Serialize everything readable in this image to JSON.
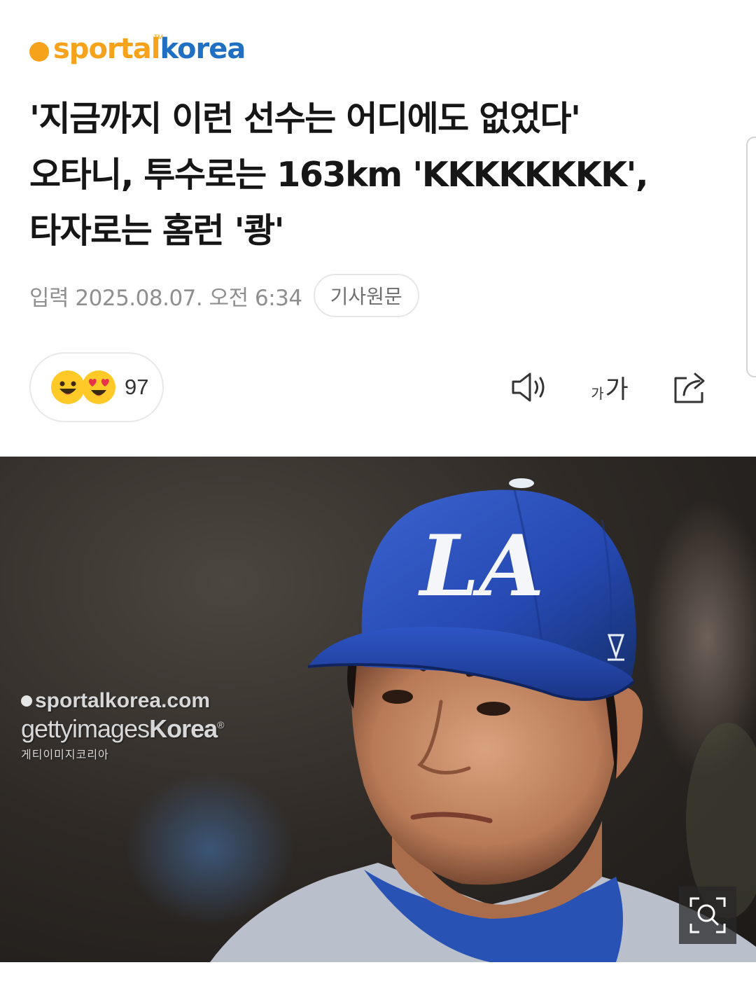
{
  "brand": {
    "logo_prefix": "sport",
    "logo_middle": "al",
    "logo_suffix": "korea",
    "tm": "TM",
    "colors": {
      "orange": "#f7a21b",
      "blue": "#1f6fc3"
    }
  },
  "article": {
    "title_lines": [
      "'지금까지 이런 선수는 어디에도 없었다'",
      "오타니, 투수로는 163km 'KKKKKKKK',",
      "타자로는 홈런 '쾅'"
    ],
    "published": "입력 2025.08.07. 오전 6:34",
    "original_button": "기사원문"
  },
  "reactions": {
    "count": "97",
    "icons": [
      "smile-emoji-icon",
      "heart-eyes-emoji-icon"
    ]
  },
  "toolbar": {
    "font_small": "가",
    "font_big": "가",
    "icons": [
      "speaker-icon",
      "font-size-icon",
      "share-icon"
    ]
  },
  "photo": {
    "watermark_site": "sportalkorea.com",
    "watermark_getty_a": "gettyimages",
    "watermark_getty_b": "Korea",
    "watermark_registered": "®",
    "watermark_kr": "게티이미지코리아",
    "cap_logo": "LA",
    "zoom_icon": "zoom-icon"
  }
}
